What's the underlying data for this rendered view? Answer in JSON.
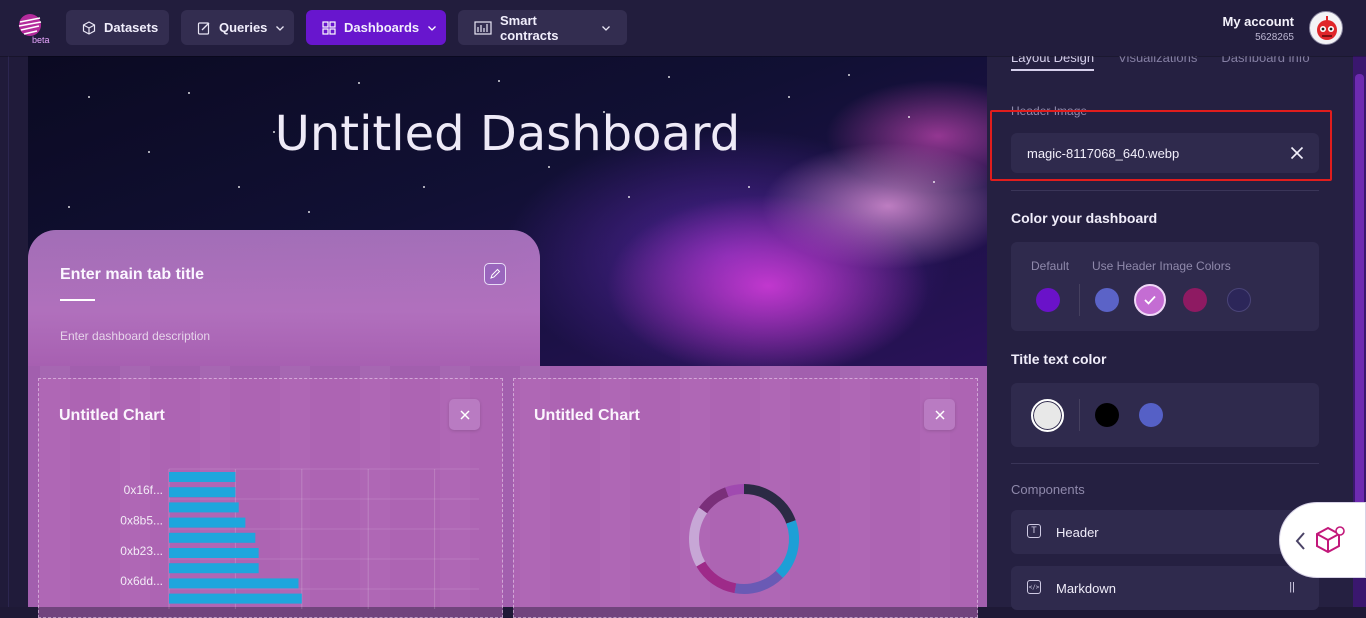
{
  "app": {
    "logo_badge": "beta"
  },
  "nav": {
    "datasets": "Datasets",
    "queries": "Queries",
    "dashboards": "Dashboards",
    "smart_contracts": "Smart contracts"
  },
  "account": {
    "label": "My account",
    "id": "5628265"
  },
  "hero": {
    "title": "Untitled Dashboard"
  },
  "main_tab": {
    "title": "Enter main tab title",
    "description": "Enter dashboard description"
  },
  "charts": [
    {
      "title": "Untitled Chart",
      "chart_data": {
        "type": "bar",
        "orientation": "horizontal",
        "tick_labels": [
          "0x16f...",
          "0x8b5...",
          "0xb23...",
          "0x6dd..."
        ],
        "bar_color": "#1ea6dd",
        "values": [
          20,
          20,
          21,
          23,
          26,
          27,
          27,
          39,
          40
        ]
      }
    },
    {
      "title": "Untitled Chart",
      "chart_data": {
        "type": "pie",
        "style": "donut",
        "colors": [
          "#2b2a44",
          "#1d9fd6",
          "#6a5ab5",
          "#9e2a89",
          "#c7a7d6",
          "#7a2f7a",
          "#a04ab0"
        ]
      }
    }
  ],
  "panel": {
    "tabs": [
      "Layout Design",
      "Visualizations",
      "Dashboard info"
    ],
    "header_image_label": "Header Image",
    "header_image_file": "magic-8117068_640.webp",
    "color_heading": "Color your dashboard",
    "default_label": "Default",
    "header_colors_label": "Use Header Image Colors",
    "color_swatches": [
      "#6a12c9",
      "#5b63c7",
      "#c46dd3",
      "#8e1a62",
      "#2c2659"
    ],
    "title_color_heading": "Title text color",
    "title_swatches": [
      "#e8e8e8",
      "#000000",
      "#5560c6"
    ],
    "components_label": "Components",
    "components": [
      {
        "name": "Header",
        "icon": "T"
      },
      {
        "name": "Markdown",
        "icon": "</>"
      }
    ]
  }
}
